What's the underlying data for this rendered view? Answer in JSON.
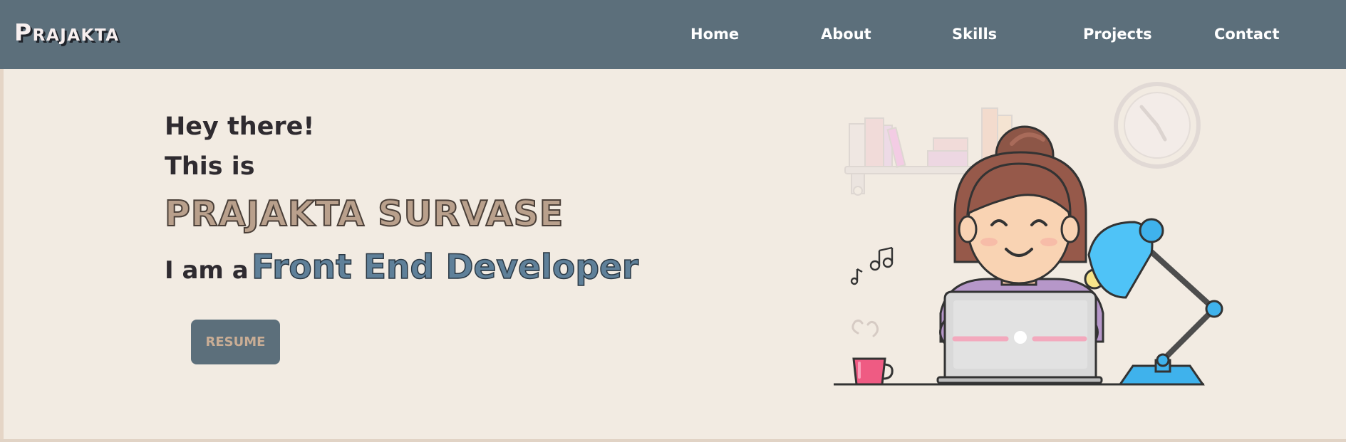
{
  "brand": {
    "name": "Prajakta"
  },
  "nav": {
    "items": [
      {
        "label": "Home"
      },
      {
        "label": "About"
      },
      {
        "label": "Skills"
      },
      {
        "label": "Projects"
      },
      {
        "label": "Contact"
      }
    ]
  },
  "hero": {
    "greeting": "Hey there!",
    "intro": "This is",
    "name": "PRAJAKTA SURVASE",
    "role_prefix": "I am a",
    "role": "Front End Developer",
    "resume_label": "RESUME"
  },
  "icons": {
    "illustration": "girl-with-laptop-illustration",
    "shelf": "bookshelf-icon",
    "clock": "wall-clock-icon",
    "music": "music-notes-icon",
    "lamp": "desk-lamp-icon",
    "cup": "coffee-cup-icon",
    "laptop": "laptop-icon"
  },
  "colors": {
    "navbar": "#5c6f7b",
    "background": "#f2ebe2",
    "name": "#b9a08c",
    "role": "#5f8099",
    "button": "#5c6f7b",
    "button_text": "#c9ad95"
  }
}
